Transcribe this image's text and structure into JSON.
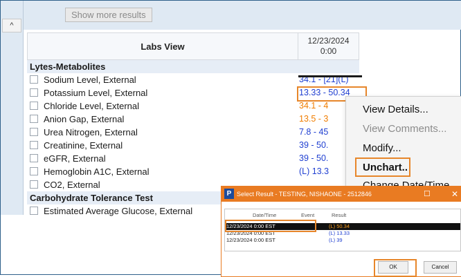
{
  "toolbar": {
    "show_more": "Show more results",
    "scroll_up": "^"
  },
  "labs": {
    "title": "Labs View",
    "date_col": [
      "12/23/2024",
      "0:00"
    ],
    "sections": [
      {
        "name": "Lytes-Metabolites"
      },
      {
        "name": "Carbohydrate Tolerance Test"
      }
    ],
    "rows": [
      {
        "label": "Sodium Level, External",
        "value": "34.1 - [21](L)"
      },
      {
        "label": "Potassium Level, External",
        "value": "13.33 - 50.34"
      },
      {
        "label": "Chloride Level, External",
        "value": "34.1 - 4"
      },
      {
        "label": "Anion Gap, External",
        "value": "13.5 - 3"
      },
      {
        "label": "Urea Nitrogen, External",
        "value": "7.8 - 45"
      },
      {
        "label": "Creatinine, External",
        "value": "39 - 50."
      },
      {
        "label": "eGFR, External",
        "value": "39 - 50."
      },
      {
        "label": "Hemoglobin A1C, External",
        "value": "(L) 13.3"
      },
      {
        "label": "CO2, External",
        "value": ""
      },
      {
        "label": "Estimated Average Glucose, External",
        "value": ""
      }
    ]
  },
  "context_menu": {
    "items": [
      "View Details...",
      "View Comments...",
      "Modify...",
      "Unchart..",
      "Change Date/Time"
    ]
  },
  "dialog": {
    "icon": "P",
    "title": "Select Result - TESTING, NISHAONE - 2512846",
    "minimize": "☐",
    "close": "✕",
    "cols": [
      "Date/Time",
      "Event",
      "Result"
    ],
    "rows": [
      {
        "date": "12/23/2024 0:00 EST",
        "value": "(L) 50.34"
      },
      {
        "date": "12/23/2024 0:00 EST",
        "value": "(L) 13.33"
      },
      {
        "date": "12/23/2024 0:00 EST",
        "value": "(L) 39"
      }
    ],
    "ok": "OK",
    "cancel": "Cancel"
  }
}
